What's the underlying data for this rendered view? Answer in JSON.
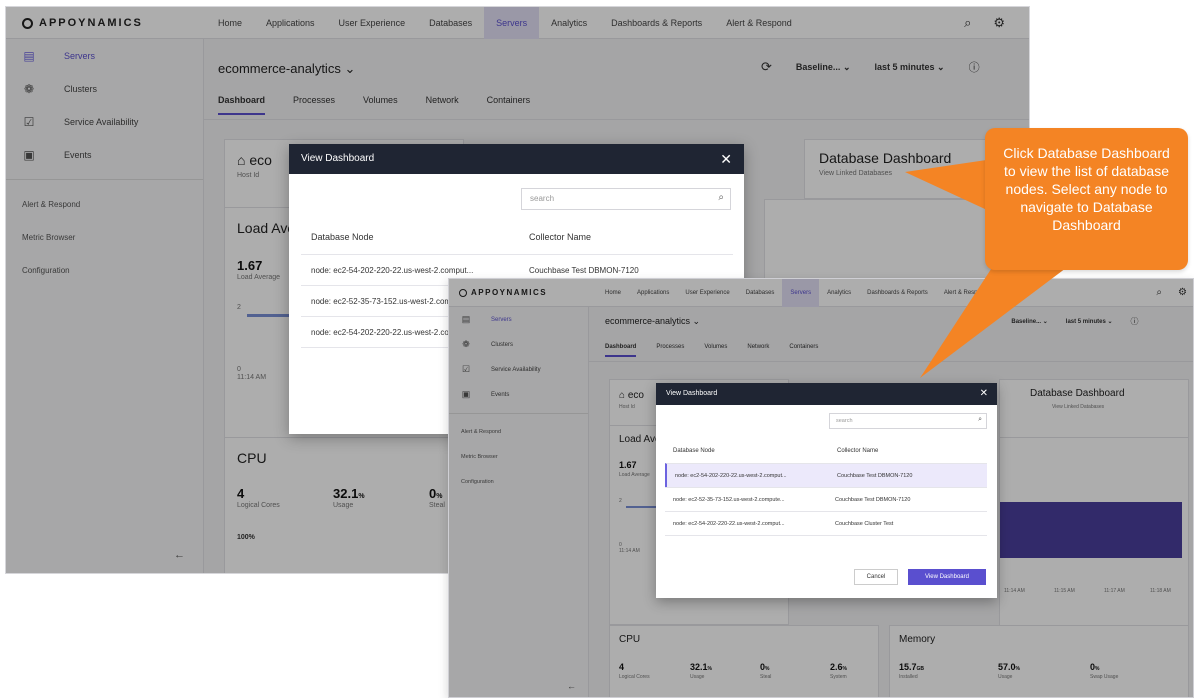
{
  "app": {
    "logo": "APPOYNAMICS",
    "nav": [
      "Home",
      "Applications",
      "User Experience",
      "Databases",
      "Servers",
      "Analytics",
      "Dashboards & Reports",
      "Alert & Respond"
    ],
    "active_nav_index": 4,
    "sidebar": {
      "items": [
        {
          "label": "Servers",
          "icon": "servers-icon"
        },
        {
          "label": "Clusters",
          "icon": "clusters-icon"
        },
        {
          "label": "Service Availability",
          "icon": "service-availability-icon"
        },
        {
          "label": "Events",
          "icon": "events-icon"
        }
      ],
      "links": [
        "Alert & Respond",
        "Metric Browser",
        "Configuration"
      ]
    },
    "app_title": "ecommerce-analytics",
    "baseline_label": "Baseline...",
    "time_range_label": "last 5 minutes",
    "tabs": [
      "Dashboard",
      "Processes",
      "Volumes",
      "Network",
      "Containers"
    ]
  },
  "background": {
    "host_card_title": "eco",
    "host_card_sub": "Host Id",
    "load_title": "Load Ave",
    "load_value": "1.67",
    "load_sub": "Load Average",
    "load_tick_2": "2",
    "load_tick_0": "0",
    "load_time": "11:14 AM",
    "db_title": "Database Dashboard",
    "db_sub": "View Linked Databases",
    "cpu_title": "CPU",
    "cpu_cores": "4",
    "cpu_cores_label": "Logical Cores",
    "cpu_usage": "32.1",
    "cpu_usage_label": "Usage",
    "cpu_steal": "0",
    "cpu_steal_label": "Steal",
    "cpu_system": "2.6",
    "cpu_system_label": "System",
    "pct_unit": "%",
    "pct_100": "100%",
    "memory_title": "Memory",
    "mem_installed": "15.7",
    "mem_installed_unit": "GB",
    "mem_installed_label": "Installed",
    "mem_usage": "57.0",
    "mem_usage_label": "Usage",
    "mem_swap": "0",
    "mem_swap_label": "Swap Usage",
    "time_ticks": [
      "11:14 AM",
      "11:15 AM",
      "11:17 AM",
      "11:18 AM"
    ]
  },
  "modal": {
    "title": "View Dashboard",
    "search_placeholder": "search",
    "col_node": "Database Node",
    "col_collector": "Collector Name",
    "rows": [
      {
        "node": "node: ec2-54-202-220-22.us-west-2.comput...",
        "collector": "Couchbase Test DBMON-7120"
      },
      {
        "node": "node: ec2-52-35-73-152.us-west-2.compute...",
        "collector": "Couchbase Test DBMON-7120"
      },
      {
        "node": "node: ec2-54-202-220-22.us-west-2.comput...",
        "collector": "Couchbase Cluster Test"
      }
    ],
    "selected_row_index": 0,
    "cancel_label": "Cancel",
    "confirm_label": "View Dashboard"
  },
  "callout": {
    "text": "Click Database Dashboard to view the list of database nodes. Select any node to navigate to Database Dashboard",
    "color": "#f48424"
  },
  "colors": {
    "accent": "#5a4fcf",
    "modal_header": "#1f2533",
    "chart_fill": "#4b3f9c"
  }
}
